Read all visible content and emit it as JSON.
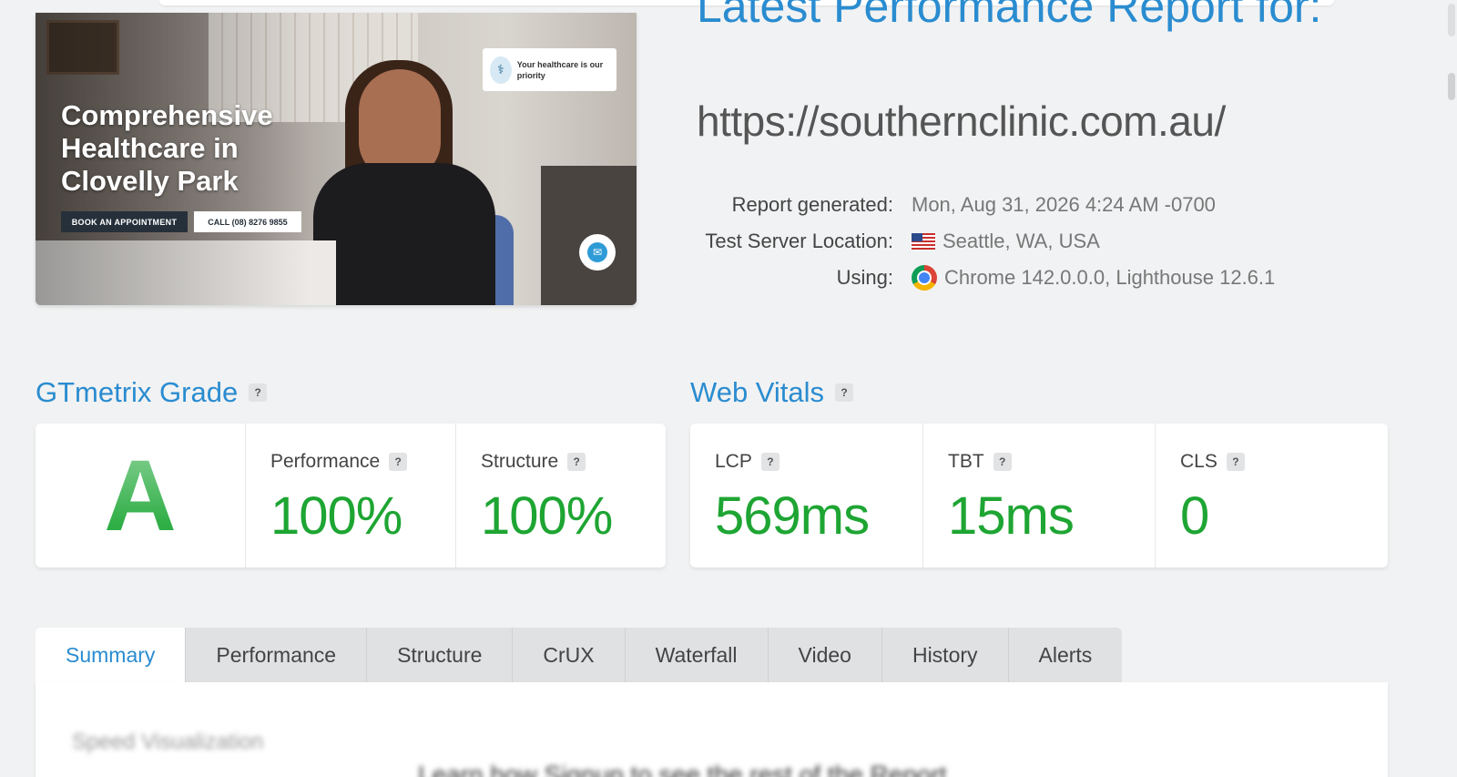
{
  "thumbnail": {
    "hero_title": "Comprehensive Healthcare in Clovelly Park",
    "book_button": "BOOK AN APPOINTMENT",
    "call_button": "CALL (08) 8276 9855",
    "badge_text": "Your healthcare is our priority"
  },
  "report": {
    "heading": "Latest Performance Report for:",
    "url": "https://southernclinic.com.au/",
    "meta": [
      {
        "label": "Report generated:",
        "value": "Mon, Aug 31, 2026 4:24 AM -0700",
        "icon": ""
      },
      {
        "label": "Test Server Location:",
        "value": "Seattle, WA, USA",
        "icon": "us-flag-icon"
      },
      {
        "label": "Using:",
        "value": "Chrome 142.0.0.0, Lighthouse 12.6.1",
        "icon": "chrome-icon"
      }
    ]
  },
  "grade": {
    "title": "GTmetrix Grade",
    "help": "?",
    "letter": "A",
    "performance_label": "Performance",
    "performance_value": "100%",
    "structure_label": "Structure",
    "structure_value": "100%"
  },
  "vitals": {
    "title": "Web Vitals",
    "help": "?",
    "lcp_label": "LCP",
    "lcp_value": "569ms",
    "tbt_label": "TBT",
    "tbt_value": "15ms",
    "cls_label": "CLS",
    "cls_value": "0"
  },
  "tabs": [
    "Summary",
    "Performance",
    "Structure",
    "CrUX",
    "Waterfall",
    "Video",
    "History",
    "Alerts"
  ],
  "active_tab": "Summary",
  "panel": {
    "blurred_heading": "Speed Visualization",
    "blurred_text": "Learn how Signup to see the rest of the Report"
  },
  "colors": {
    "accent": "#2a8cd0",
    "good": "#1ea533"
  }
}
